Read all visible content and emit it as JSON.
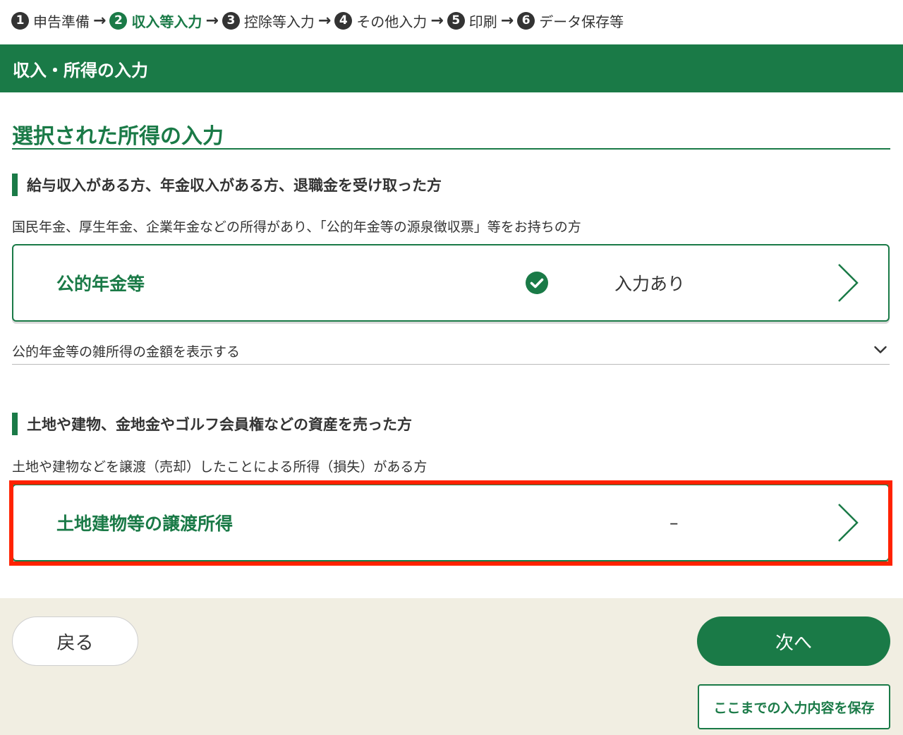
{
  "stepper": {
    "steps": [
      {
        "num": "1",
        "label": "申告準備"
      },
      {
        "num": "2",
        "label": "収入等入力"
      },
      {
        "num": "3",
        "label": "控除等入力"
      },
      {
        "num": "4",
        "label": "その他入力"
      },
      {
        "num": "5",
        "label": "印刷"
      },
      {
        "num": "6",
        "label": "データ保存等"
      }
    ],
    "arrow": "→",
    "active_step": "2"
  },
  "section_header": "収入・所得の入力",
  "page_title": "選択された所得の入力",
  "groups": [
    {
      "heading": "給与収入がある方、年金収入がある方、退職金を受け取った方",
      "description": "国民年金、厚生年金、企業年金などの所得があり、「公的年金等の源泉徴収票」等をお持ちの方",
      "card": {
        "label": "公的年金等",
        "status": "入力あり",
        "status_icon": "check-circle-icon"
      },
      "accordion": {
        "label": "公的年金等の雑所得の金額を表示する",
        "icon": "chevron-down-icon"
      }
    },
    {
      "heading": "土地や建物、金地金やゴルフ会員権などの資産を売った方",
      "description": "土地や建物などを譲渡（売却）したことによる所得（損失）がある方",
      "card": {
        "label": "土地建物等の譲渡所得",
        "status": "–"
      }
    }
  ],
  "footer": {
    "back_label": "戻る",
    "next_label": "次へ",
    "save_label": "ここまでの入力内容を保存"
  },
  "colors": {
    "brand_green": "#1a7a47",
    "highlight_red": "#ff2200",
    "footer_bg": "#f1eee2"
  }
}
